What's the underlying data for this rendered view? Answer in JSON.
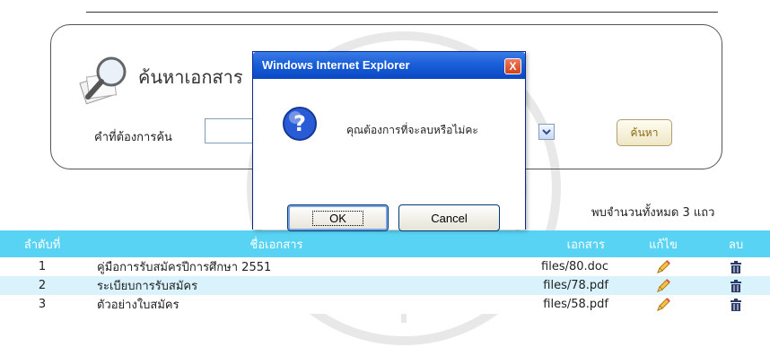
{
  "search": {
    "title": "ค้นหาเอกสาร",
    "keyword_label": "คำที่ต้องการค้น",
    "keyword_value": "",
    "button_label": "ค้นหา"
  },
  "dialog": {
    "title": "Windows Internet Explorer",
    "close_label": "X",
    "message": "คุณต้องการที่จะลบหรือไม่คะ",
    "ok_label": "OK",
    "cancel_label": "Cancel"
  },
  "results": {
    "count_text": "พบจำนวนทั้งหมด  3 แถว"
  },
  "table": {
    "headers": {
      "no": "ลำดับที่",
      "name": "ชื่อเอกสาร",
      "file": "เอกสาร",
      "edit": "แก้ไข",
      "delete": "ลบ"
    },
    "rows": [
      {
        "no": "1",
        "name": "คู่มือการรับสมัครปีการศึกษา 2551",
        "file": "files/80.doc"
      },
      {
        "no": "2",
        "name": "ระเบียบการรับสมัคร",
        "file": "files/78.pdf"
      },
      {
        "no": "3",
        "name": "ตัวอย่างใบสมัคร",
        "file": "files/58.pdf"
      }
    ]
  },
  "colors": {
    "table_header": "#58d3f4",
    "row_alt": "#d9f2fb",
    "dialog_title": "#0a47c4"
  },
  "icons": {
    "edit": "pencil-icon",
    "delete": "trash-icon",
    "search": "magnifier-icon",
    "dialog": "question-icon"
  }
}
